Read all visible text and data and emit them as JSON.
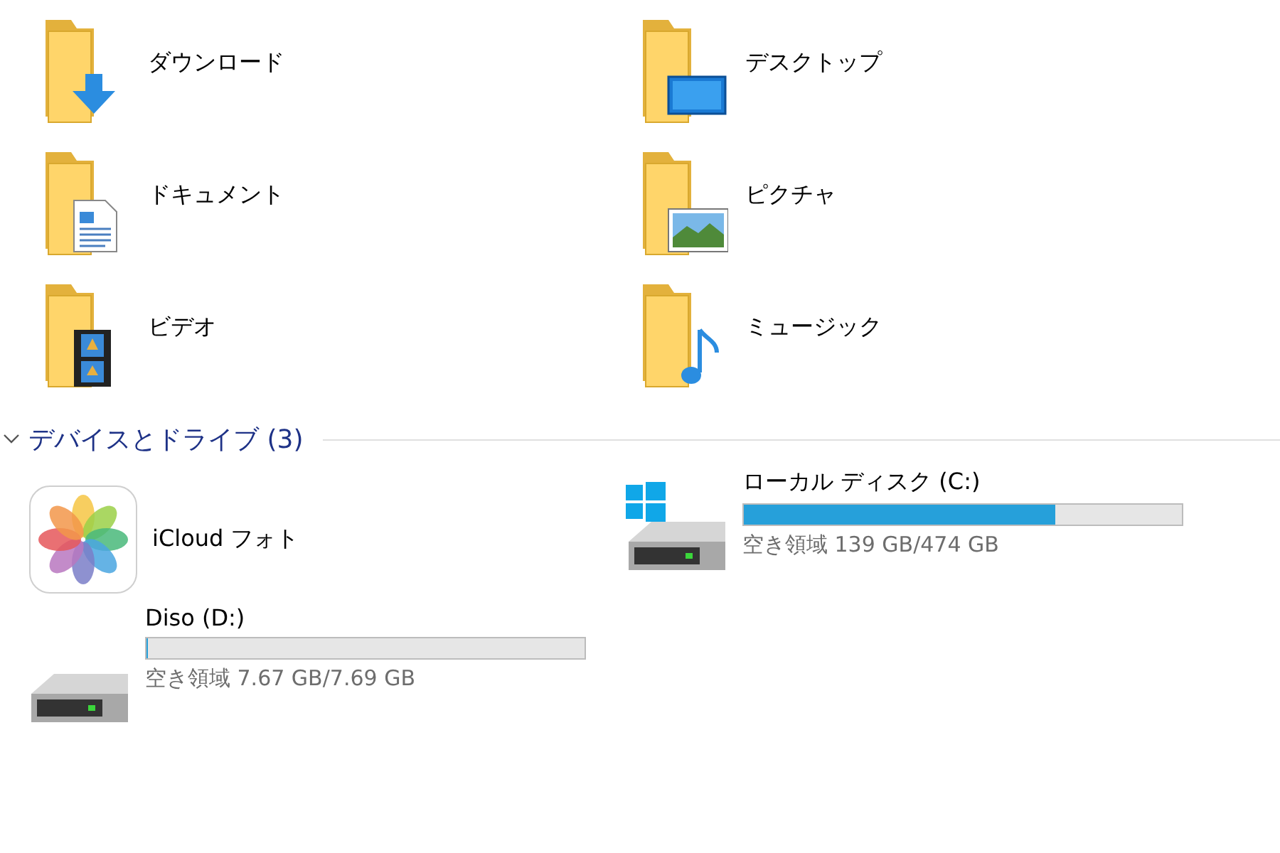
{
  "folders": [
    {
      "name": "ダウンロード",
      "kind": "downloads"
    },
    {
      "name": "デスクトップ",
      "kind": "desktop"
    },
    {
      "name": "ドキュメント",
      "kind": "documents"
    },
    {
      "name": "ピクチャ",
      "kind": "pictures"
    },
    {
      "name": "ビデオ",
      "kind": "videos"
    },
    {
      "name": "ミュージック",
      "kind": "music"
    }
  ],
  "devices_section": {
    "title": "デバイスとドライブ (3)",
    "expanded": true,
    "items": [
      {
        "kind": "app",
        "name": "iCloud フォト"
      },
      {
        "kind": "system-drive",
        "name": "ローカル ディスク (C:)",
        "level": 0.71,
        "free": "空き領域 139 GB/474 GB"
      },
      {
        "kind": "drive",
        "name": "Diso (D:)",
        "level": 0.003,
        "free": "空き領域 7.67 GB/7.69 GB"
      }
    ]
  }
}
